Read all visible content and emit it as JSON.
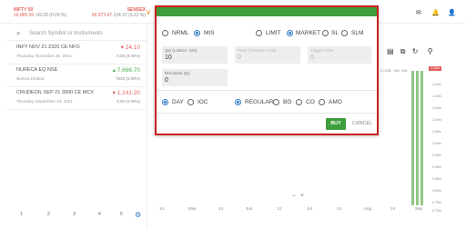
{
  "header": {
    "nifty": {
      "name": "NIFTY 50",
      "value": "16,885.50",
      "change": "-99.20 (0.29 %)"
    },
    "sensex": {
      "name": "SENSEX",
      "value": "56,973.47",
      "change": "124.37 (0.22 %)"
    }
  },
  "watchlist": {
    "search_placeholder": "Search Symbol or Instruments",
    "items": [
      {
        "symbol": "INFY NOV 21 2320 CE NFO",
        "subtitle": "Thursday, November 25, 2021",
        "price": "▾ 24.10",
        "change": "0.00 (0.00%)",
        "color": "#e25f5b"
      },
      {
        "symbol": "NURECA EQ NSE",
        "subtitle": "Nureca Limited",
        "price": "▴ 7,666.70",
        "change": "7533 (5.00%)",
        "color": "#4caf50"
      },
      {
        "symbol": "CRUDEOIL SEP 21 3900 CE MCX",
        "subtitle": "Thursday, September 16, 2021",
        "price": "▾ 1,141.20",
        "change": "0.00 (0.00%)",
        "color": "#e25f5b"
      }
    ],
    "pages": [
      "1",
      "2",
      "3",
      "4",
      "5"
    ]
  },
  "order": {
    "product": {
      "nrml": "NRML",
      "mis": "MIS",
      "selected": "MIS"
    },
    "type": {
      "limit": "LIMIT",
      "market": "MARKET",
      "sl": "SL",
      "slm": "SLM",
      "selected": "MARKET"
    },
    "qty": {
      "label": "Qty (Lotsize: 100)",
      "value": "10"
    },
    "price": {
      "label": "Price (TickSize: 0.05)",
      "value": "0"
    },
    "trigger": {
      "label": "Trigger Price",
      "value": "0"
    },
    "disclosed": {
      "label": "Disclosed Qty",
      "value": "0"
    },
    "validity": {
      "day": "DAY",
      "ioc": "IOC",
      "selected": "DAY"
    },
    "variety": {
      "regular": "REGULAR",
      "bo": "BO",
      "co": "CO",
      "amo": "AMO",
      "selected": "REGULAR"
    },
    "buy_label": "BUY",
    "cancel_label": "CANCEL"
  },
  "chart": {
    "x_labels": [
      "14",
      "May",
      "14",
      "Jun",
      "14",
      "Jul",
      "14",
      "Aug",
      "14",
      "Sep"
    ],
    "y_labels": [
      "1,25m",
      "1,20m",
      "1,15m",
      "1,10m",
      "1,05m",
      "1,00m",
      "0.95m",
      "0.90m",
      "0.85m",
      "0.80m",
      "0.75m",
      "0.70m"
    ],
    "last_price_tag": "1.24m",
    "legend": [
      "CLOSE",
      "N/A",
      "N/A"
    ],
    "zoom_minus": "−",
    "zoom_plus": "+"
  }
}
